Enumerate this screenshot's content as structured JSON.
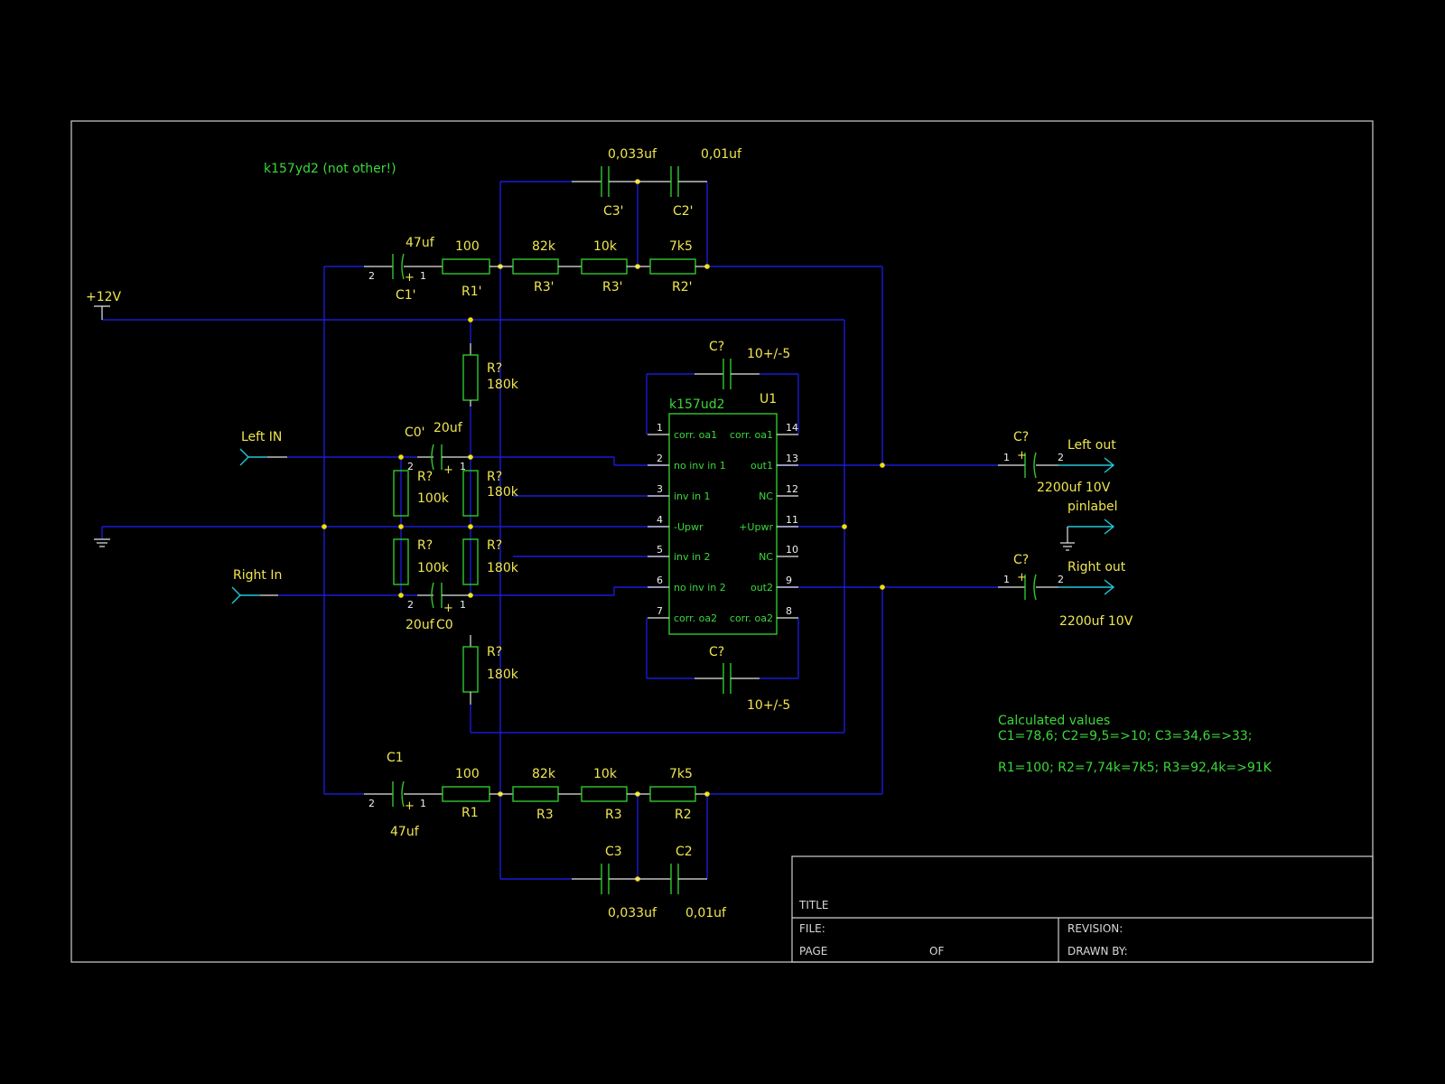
{
  "schematic": {
    "title_note": "k157yd2 (not other!)",
    "supply_label": "+12V",
    "ports": {
      "left_in": "Left IN",
      "right_in": "Right In",
      "left_out": "Left out",
      "right_out": "Right out",
      "gnd_out": "pinlabel"
    },
    "top_chain": {
      "c1_value": "47uf",
      "c1_ref": "C1'",
      "r1_value": "100",
      "r1_ref": "R1'",
      "r3a_value": "82k",
      "r3a_ref": "R3'",
      "r3b_value": "10k",
      "r3b_ref": "R3'",
      "r2_value": "7k5",
      "r2_ref": "R2'",
      "c3_value": "0,033uf",
      "c3_ref": "C3'",
      "c2_value": "0,01uf",
      "c2_ref": "C2'"
    },
    "bottom_chain": {
      "c1_value": "47uf",
      "c1_ref": "C1",
      "r1_value": "100",
      "r1_ref": "R1",
      "r3a_value": "82k",
      "r3a_ref": "R3",
      "r3b_value": "10k",
      "r3b_ref": "R3",
      "r2_value": "7k5",
      "r2_ref": "R2",
      "c3_value": "0,033uf",
      "c3_ref": "C3",
      "c2_value": "0,01uf",
      "c2_ref": "C2"
    },
    "bias": {
      "r_top": {
        "ref": "R?",
        "value": "180k"
      },
      "r_mid_top": {
        "ref": "R?",
        "value": "180k"
      },
      "r_mid_bot": {
        "ref": "R?",
        "value": "180k"
      },
      "r_bottom": {
        "ref": "R?",
        "value": "180k"
      },
      "r_in_top": {
        "ref": "R?",
        "value": "100k"
      },
      "r_in_bot": {
        "ref": "R?",
        "value": "100k"
      },
      "c_in_top": {
        "ref": "C0'",
        "value": "20uf"
      },
      "c_in_bot": {
        "ref": "C0",
        "value": "20uf"
      }
    },
    "corr_caps": {
      "top": {
        "ref": "C?",
        "value": "10+/-5"
      },
      "bottom": {
        "ref": "C?",
        "value": "10+/-5"
      }
    },
    "output_caps": {
      "left": {
        "ref": "C?",
        "value": "2200uf 10V"
      },
      "right": {
        "ref": "C?",
        "value": "2200uf 10V"
      }
    },
    "ic": {
      "part": "k157ud2",
      "ref": "U1",
      "left_pins": [
        {
          "num": "1",
          "name": "corr. oa1"
        },
        {
          "num": "2",
          "name": "no inv in 1"
        },
        {
          "num": "3",
          "name": "inv in 1"
        },
        {
          "num": "4",
          "name": "-Upwr"
        },
        {
          "num": "5",
          "name": "inv in 2"
        },
        {
          "num": "6",
          "name": "no inv in 2"
        },
        {
          "num": "7",
          "name": "corr. oa2"
        }
      ],
      "right_pins": [
        {
          "num": "14",
          "name": "corr. oa1"
        },
        {
          "num": "13",
          "name": "out1"
        },
        {
          "num": "12",
          "name": "NC"
        },
        {
          "num": "11",
          "name": "+Upwr"
        },
        {
          "num": "10",
          "name": "NC"
        },
        {
          "num": "9",
          "name": "out2"
        },
        {
          "num": "8",
          "name": "corr. oa2"
        }
      ]
    },
    "pin_numbers": {
      "one": "1",
      "two": "2"
    },
    "notes": {
      "heading": "Calculated values",
      "line1": "C1=78,6; C2=9,5=>10; C3=34,6=>33;",
      "line2": "R1=100; R2=7,74k=7k5; R3=92,4k=>91K"
    }
  },
  "title_block": {
    "title": "TITLE",
    "file": "FILE:",
    "page": "PAGE",
    "of": "OF",
    "revision": "REVISION:",
    "drawn_by": "DRAWN BY:"
  }
}
